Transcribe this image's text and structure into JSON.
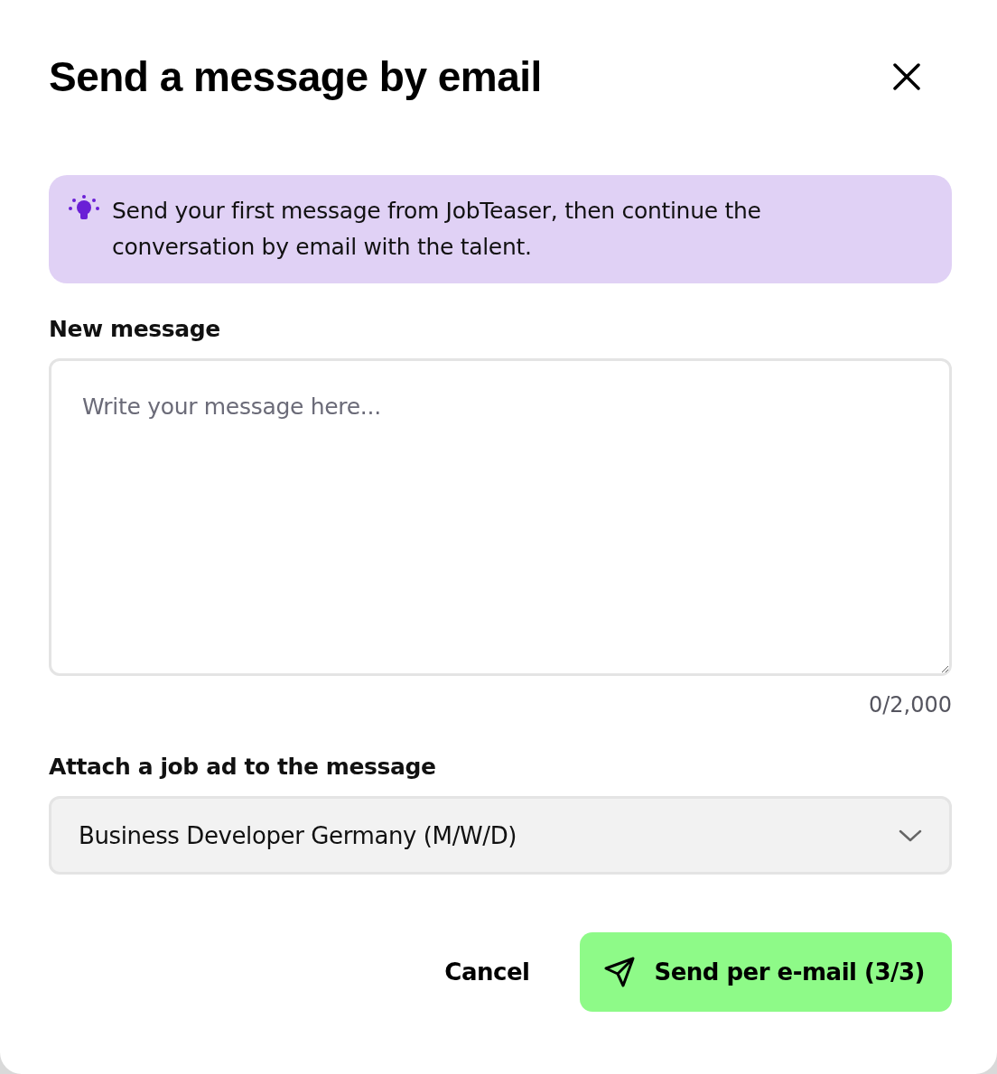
{
  "dialog": {
    "title": "Send a message by email"
  },
  "banner": {
    "text": "Send your first message from JobTeaser, then continue the conversation by email with the talent."
  },
  "message": {
    "label": "New message",
    "placeholder": "Write your message here...",
    "counter": "0/2,000"
  },
  "job_ad": {
    "label": "Attach a job ad to the message",
    "value": "Business Developer Germany (M/W/D)"
  },
  "buttons": [
    {
      "kind": "text",
      "label": "Cancel"
    },
    {
      "kind": "primary",
      "label": "Send per e-mail (3/3)"
    }
  ]
}
